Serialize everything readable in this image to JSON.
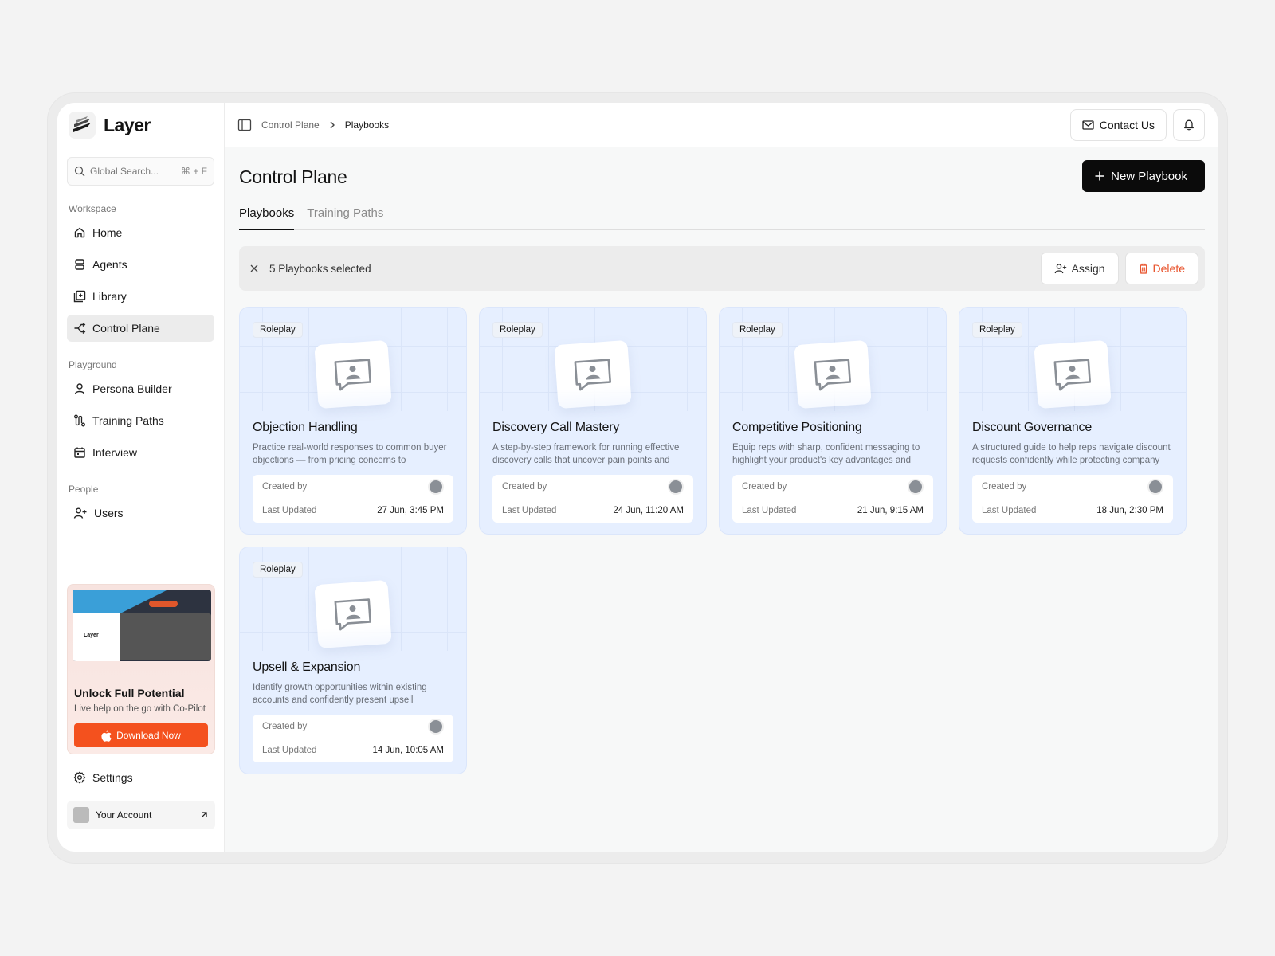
{
  "brand": {
    "name": "Layer"
  },
  "search": {
    "placeholder": "Global Search...",
    "shortcut": "⌘ + F"
  },
  "sidebar": {
    "sections": [
      {
        "label": "Workspace",
        "items": [
          {
            "label": "Home",
            "icon": "home-icon"
          },
          {
            "label": "Agents",
            "icon": "agents-icon"
          },
          {
            "label": "Library",
            "icon": "library-icon"
          },
          {
            "label": "Control Plane",
            "icon": "control-plane-icon",
            "active": true
          }
        ]
      },
      {
        "label": "Playground",
        "items": [
          {
            "label": "Persona Builder",
            "icon": "persona-icon"
          },
          {
            "label": "Training Paths",
            "icon": "path-icon"
          },
          {
            "label": "Interview",
            "icon": "calendar-icon"
          }
        ]
      },
      {
        "label": "People",
        "items": [
          {
            "label": "Users",
            "icon": "users-icon"
          }
        ]
      }
    ],
    "promo": {
      "title": "Unlock Full Potential",
      "subtitle": "Live help on the go with Co-Pilot",
      "button": "Download Now",
      "shot_brand": "Layer"
    },
    "settings": "Settings",
    "account": "Your Account"
  },
  "topbar": {
    "breadcrumb": [
      "Control Plane",
      "Playbooks"
    ],
    "contact": "Contact Us"
  },
  "page": {
    "title": "Control Plane",
    "new_button": "New Playbook",
    "tabs": [
      "Playbooks",
      "Training Paths"
    ],
    "active_tab": 0
  },
  "selection": {
    "text": "5 Playbooks selected",
    "assign": "Assign",
    "delete": "Delete"
  },
  "labels": {
    "created_by": "Created by",
    "last_updated": "Last Updated"
  },
  "cards": [
    {
      "tag": "Roleplay",
      "title": "Objection Handling",
      "desc": "Practice real-world responses to common buyer objections — from pricing concerns to competitor...",
      "updated": "27 Jun, 3:45 PM"
    },
    {
      "tag": "Roleplay",
      "title": "Discovery Call Mastery",
      "desc": "A step-by-step framework for running effective discovery calls that uncover pain points and build...",
      "updated": "24 Jun, 11:20 AM"
    },
    {
      "tag": "Roleplay",
      "title": "Competitive Positioning",
      "desc": "Equip reps with sharp, confident messaging to highlight your product's key advantages and differ...",
      "updated": "21 Jun, 9:15 AM"
    },
    {
      "tag": "Roleplay",
      "title": "Discount Governance",
      "desc": "A structured guide to help reps navigate discount requests confidently while protecting company m...",
      "updated": "18 Jun, 2:30 PM"
    },
    {
      "tag": "Roleplay",
      "title": "Upsell & Expansion",
      "desc": "Identify growth opportunities within existing accounts and confidently present upsell solutions...",
      "updated": "14 Jun, 10:05 AM"
    }
  ],
  "colors": {
    "accent": "#f4511e",
    "card_bg": "#e6efff",
    "primary": "#0b0b0b",
    "danger": "#e8512a"
  }
}
